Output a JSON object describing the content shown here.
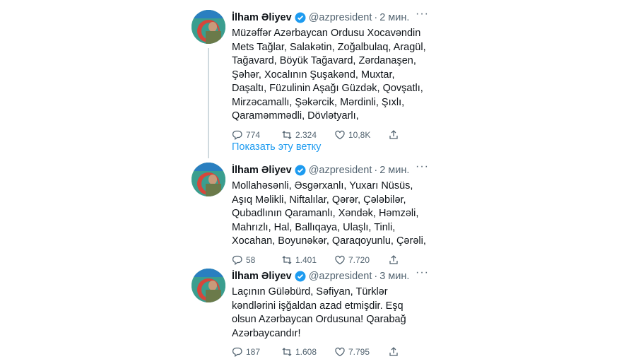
{
  "show_thread_label": "Показать эту ветку",
  "colors": {
    "accent": "#1d9bf0",
    "text": "#0f1419",
    "muted": "#536471"
  },
  "tweets": [
    {
      "name": "İlham Əliyev",
      "handle": "@azpresident",
      "separator": "·",
      "time": "2 мин.",
      "lines": [
        "Müzəffər Azərbaycan Ordusu Xocavəndin",
        "Mets Tağlar, Salakətin, Zoğalbulaq, Aragül,",
        "Tağavard, Böyük Tağavard, Zərdanaşen,",
        "Şəhər, Xocalının Şuşakənd, Muxtar,",
        "Daşaltı, Füzulinin Aşağı Güzdək, Qovşatlı,",
        "Mirzəcamallı, Şəkərcik, Mərdinli, Şıxlı,",
        "Qaraməmmədli, Dövlətyarlı,"
      ],
      "replies": "774",
      "retweets": "2.324",
      "likes": "10,8K"
    },
    {
      "name": "İlham Əliyev",
      "handle": "@azpresident",
      "separator": "·",
      "time": "2 мин.",
      "lines": [
        "Mollahəsənli, Əsgərxanlı, Yuxarı Nüsüs,",
        "Aşıq Məlikli, Niftalılar, Qərər, Çələbilər,",
        "Qubadlının Qaramanlı, Xəndək, Həmzəli,",
        "Mahrızlı, Hal, Ballıqaya, Ulaşlı, Tinli,",
        "Xocahan, Boyunəkər, Qaraqoyunlu, Çərəli,"
      ],
      "replies": "58",
      "retweets": "1.401",
      "likes": "7.720"
    },
    {
      "name": "İlham Əliyev",
      "handle": "@azpresident",
      "separator": "·",
      "time": "3 мин.",
      "lines": [
        "Laçının Güləbürd, Səfiyan, Türklər",
        "kəndlərini işğaldan azad etmişdir. Eşq",
        "olsun Azərbaycan Ordusuna! Qarabağ",
        "Azərbaycandır!"
      ],
      "replies": "187",
      "retweets": "1.608",
      "likes": "7.795"
    }
  ],
  "icons": {
    "verified": "verified-badge-icon",
    "more": "more-options-icon",
    "reply": "reply-icon",
    "retweet": "retweet-icon",
    "like": "like-icon",
    "share": "share-icon"
  }
}
